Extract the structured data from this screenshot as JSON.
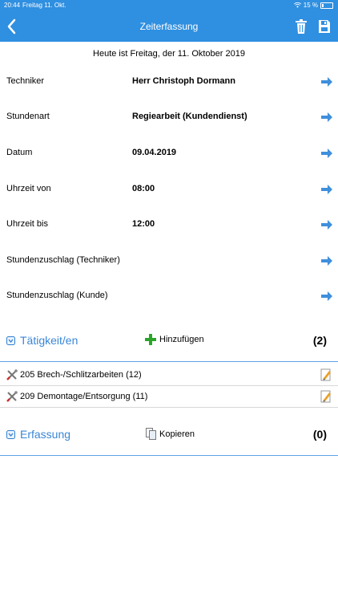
{
  "status": {
    "time": "20:44",
    "date": "Freitag 11. Okt.",
    "battery": "15 %"
  },
  "nav": {
    "title": "Zeiterfassung"
  },
  "today": "Heute ist Freitag, der 11. Oktober 2019",
  "fields": [
    {
      "label": "Techniker",
      "value": "Herr Christoph Dormann"
    },
    {
      "label": "Stundenart",
      "value": "Regiearbeit (Kundendienst)"
    },
    {
      "label": "Datum",
      "value": "09.04.2019"
    },
    {
      "label": "Uhrzeit von",
      "value": "08:00"
    },
    {
      "label": "Uhrzeit bis",
      "value": "12:00"
    },
    {
      "label": "Stundenzuschlag (Techniker)",
      "value": ""
    },
    {
      "label": "Stundenzuschlag (Kunde)",
      "value": ""
    }
  ],
  "taetigkeiten": {
    "title": "Tätigkeit/en",
    "action": "Hinzufügen",
    "count": "(2)",
    "items": [
      "205 Brech-/Schlitzarbeiten (12)",
      "209 Demontage/Entsorgung (11)"
    ]
  },
  "erfassung": {
    "title": "Erfassung",
    "action": "Kopieren",
    "count": "(0)"
  },
  "colors": {
    "accent": "#2f8fe0",
    "arrow": "#3f8fdc",
    "add": "#2aa52a"
  }
}
